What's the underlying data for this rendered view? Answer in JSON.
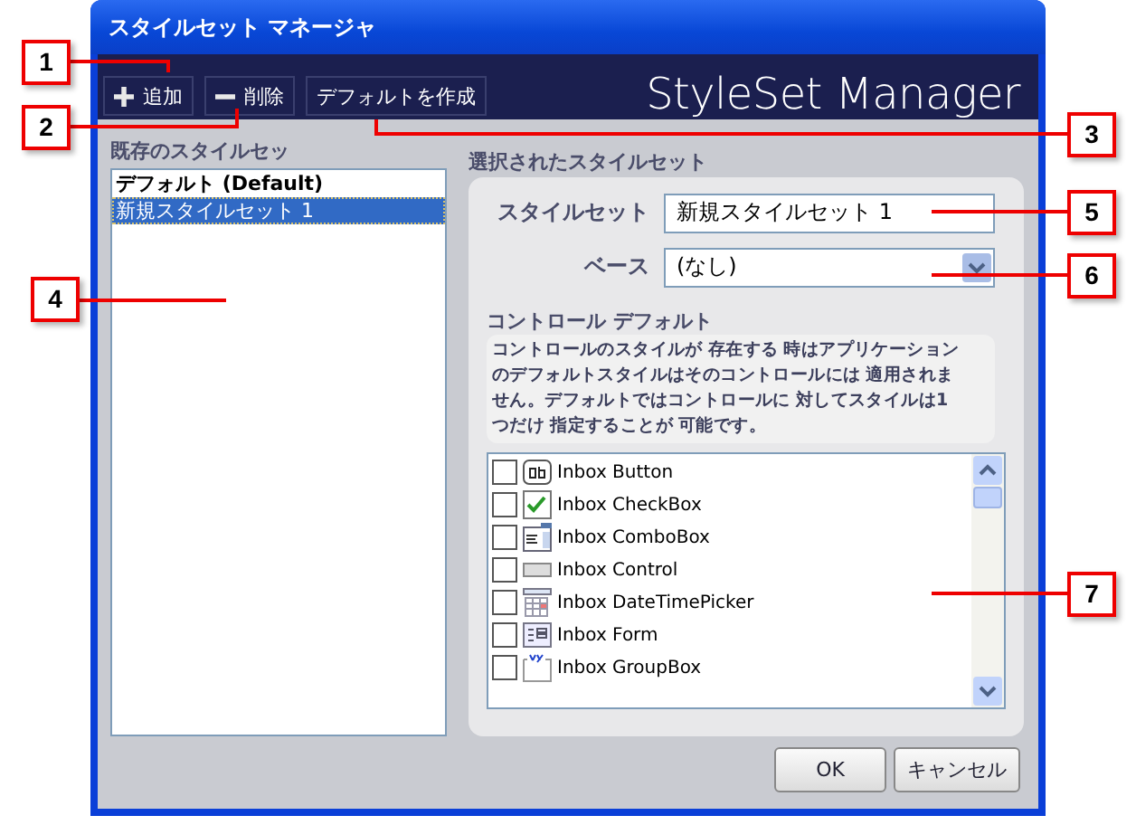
{
  "window": {
    "title": "スタイルセット マネージャ"
  },
  "toolbar": {
    "buttons": [
      {
        "kind": "add",
        "label": "追加"
      },
      {
        "kind": "remove",
        "label": "削除"
      },
      {
        "kind": "plain",
        "label": "デフォルトを作成"
      }
    ],
    "brand": "StyleSet Manager"
  },
  "existing": {
    "label": "既存のスタイルセッ",
    "items": [
      {
        "label": "デフォルト (Default)",
        "bold": true,
        "selected": false
      },
      {
        "label": "新規スタイルセット 1",
        "bold": false,
        "selected": true
      }
    ]
  },
  "selected_set": {
    "label": "選択されたスタイルセット",
    "styleset_label": "スタイルセット",
    "styleset_value": "新規スタイルセット 1",
    "base_label": "ベース",
    "base_value": "(なし)"
  },
  "control_defaults": {
    "label": "コントロール デフォルト",
    "description": "コントロールのスタイルが 存在する 時はアプリケーションのデフォルトスタイルはそのコントロールには 適用されません。デフォルトではコントロールに 対してスタイルは1つだけ 指定することが 可能です。",
    "items": [
      {
        "kind": "button",
        "label": "Inbox Button",
        "checked": false
      },
      {
        "kind": "checkbox",
        "label": "Inbox CheckBox",
        "checked": false
      },
      {
        "kind": "combobox",
        "label": "Inbox ComboBox",
        "checked": false
      },
      {
        "kind": "control",
        "label": "Inbox Control",
        "checked": false
      },
      {
        "kind": "datetime",
        "label": "Inbox DateTimePicker",
        "checked": false
      },
      {
        "kind": "form",
        "label": "Inbox Form",
        "checked": false
      },
      {
        "kind": "groupbox",
        "label": "Inbox GroupBox",
        "checked": false
      }
    ]
  },
  "buttons": [
    "OK",
    "キャンセル"
  ],
  "callouts": [
    "1",
    "2",
    "3",
    "5",
    "6",
    "4",
    "7"
  ]
}
